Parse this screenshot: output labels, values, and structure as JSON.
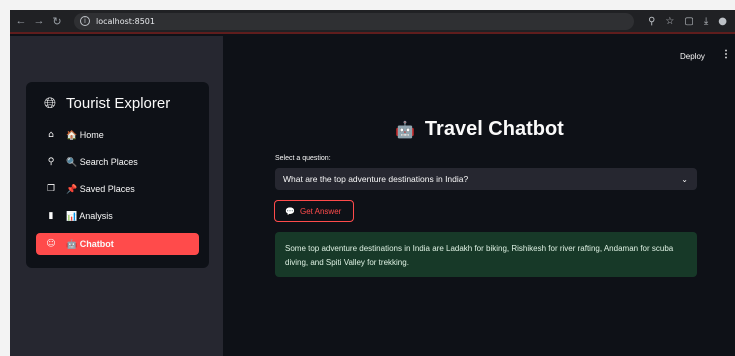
{
  "browser": {
    "back_icon": "arrow-left-icon",
    "forward_icon": "arrow-right-icon",
    "reload_icon": "reload-icon",
    "url": "localhost:8501",
    "icons": [
      "zoom-icon",
      "star-icon",
      "extensions-icon",
      "download-icon",
      "profile-icon"
    ]
  },
  "header": {
    "deploy_label": "Deploy",
    "menu_icon": "⋮"
  },
  "sidebar": {
    "title": "Tourist Explorer",
    "title_icon": "globe-icon",
    "items": [
      {
        "label": "🏠 Home",
        "icon": "home-icon",
        "active": false
      },
      {
        "label": "🔍 Search Places",
        "icon": "search-icon",
        "active": false
      },
      {
        "label": "📌 Saved Places",
        "icon": "bookmark-icon",
        "active": false
      },
      {
        "label": "📊 Analysis",
        "icon": "bar-chart-icon",
        "active": false
      },
      {
        "label": "🤖 Chatbot",
        "icon": "robot-icon",
        "active": true
      }
    ]
  },
  "main": {
    "title": "Travel Chatbot",
    "title_icon": "robot-icon",
    "select_label": "Select a question:",
    "selected_question": "What are the top adventure destinations in India?",
    "button_label": "Get Answer",
    "answer_text": "Some top adventure destinations in India are Ladakh for biking, Rishikesh for river rafting, Andaman for scuba diving, and Spiti Valley for trekking."
  },
  "colors": {
    "accent": "#ff4b4b",
    "background": "#0e1117",
    "sidebar": "#262730",
    "success_bg": "#173928"
  }
}
